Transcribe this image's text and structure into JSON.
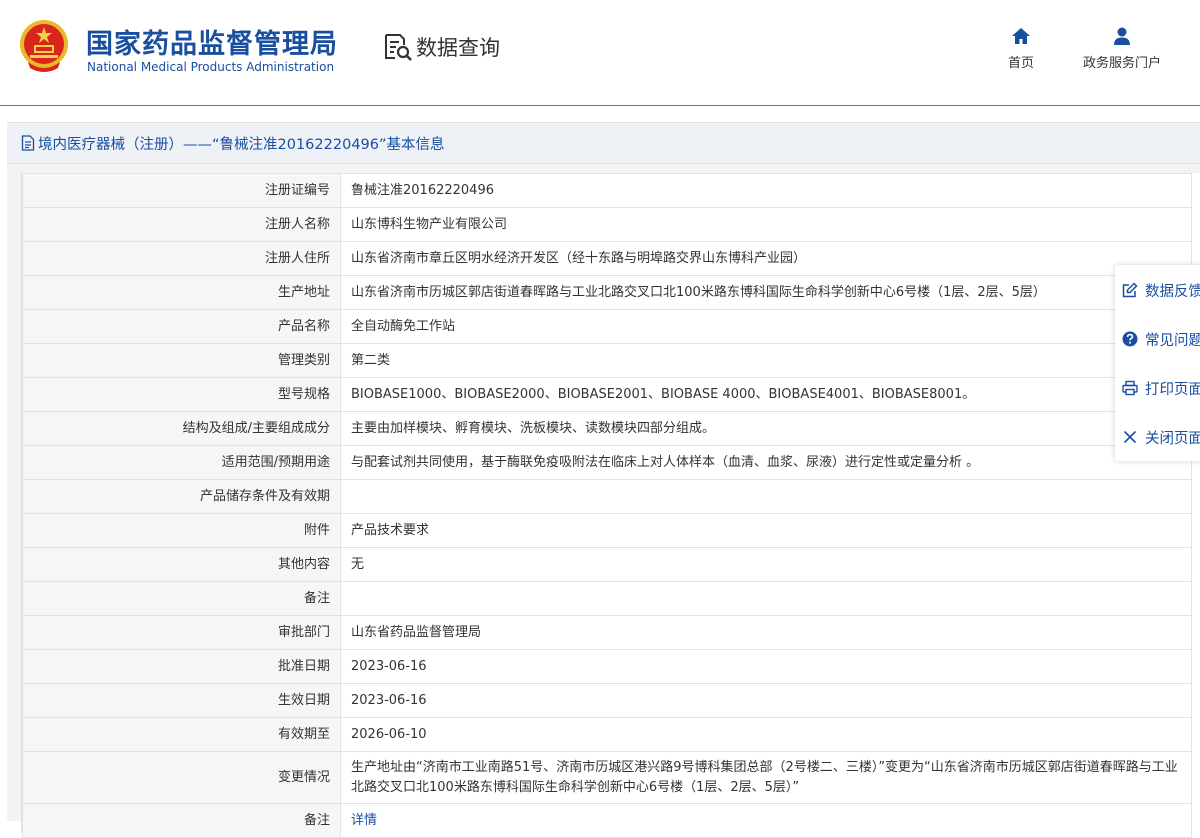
{
  "header": {
    "brand_cn": "国家药品监督管理局",
    "brand_en": "National Medical Products Administration",
    "query_label": "数据查询",
    "nav": [
      {
        "label": "首页",
        "icon": "home-icon"
      },
      {
        "label": "政务服务门户",
        "icon": "user-icon"
      }
    ]
  },
  "breadcrumb": "境内医疗器械（注册）——“鲁械注准20162220496”基本信息",
  "rows": [
    {
      "label": "注册证编号",
      "value": "鲁械注准20162220496"
    },
    {
      "label": "注册人名称",
      "value": "山东博科生物产业有限公司"
    },
    {
      "label": "注册人住所",
      "value": "山东省济南市章丘区明水经济开发区（经十东路与明埠路交界山东博科产业园）"
    },
    {
      "label": "生产地址",
      "value": "山东省济南市历城区郭店街道春晖路与工业北路交叉口北100米路东博科国际生命科学创新中心6号楼（1层、2层、5层）"
    },
    {
      "label": "产品名称",
      "value": "全自动酶免工作站"
    },
    {
      "label": "管理类别",
      "value": "第二类"
    },
    {
      "label": "型号规格",
      "value": "BIOBASE1000、BIOBASE2000、BIOBASE2001、BIOBASE 4000、BIOBASE4001、BIOBASE8001。"
    },
    {
      "label": "结构及组成/主要组成成分",
      "value": "主要由加样模块、孵育模块、洗板模块、读数模块四部分组成。"
    },
    {
      "label": "适用范围/预期用途",
      "value": "与配套试剂共同使用，基于酶联免疫吸附法在临床上对人体样本（血清、血浆、尿液）进行定性或定量分析 。"
    },
    {
      "label": "产品储存条件及有效期",
      "value": ""
    },
    {
      "label": "附件",
      "value": "产品技术要求"
    },
    {
      "label": "其他内容",
      "value": "无"
    },
    {
      "label": "备注",
      "value": ""
    },
    {
      "label": "审批部门",
      "value": "山东省药品监督管理局"
    },
    {
      "label": "批准日期",
      "value": "2023-06-16"
    },
    {
      "label": "生效日期",
      "value": "2023-06-16"
    },
    {
      "label": "有效期至",
      "value": "2026-06-10"
    },
    {
      "label": "变更情况",
      "value": "生产地址由“济南市工业南路51号、济南市历城区港兴路9号博科集团总部（2号楼二、三楼）”变更为“山东省济南市历城区郭店街道春晖路与工业北路交叉口北100米路东博科国际生命科学创新中心6号楼（1层、2层、5层）”"
    },
    {
      "label": "备注",
      "value": "详情"
    }
  ],
  "float_menu": [
    {
      "label": "数据反馈",
      "icon": "edit-icon"
    },
    {
      "label": "常见问题",
      "icon": "question-icon"
    },
    {
      "label": "打印页面",
      "icon": "print-icon"
    },
    {
      "label": "关闭页面",
      "icon": "close-icon"
    }
  ],
  "colors": {
    "brand_blue": "#1a4fa0",
    "label_bg": "#f6f6f6",
    "breadcrumb_bg": "#eef1f6"
  }
}
